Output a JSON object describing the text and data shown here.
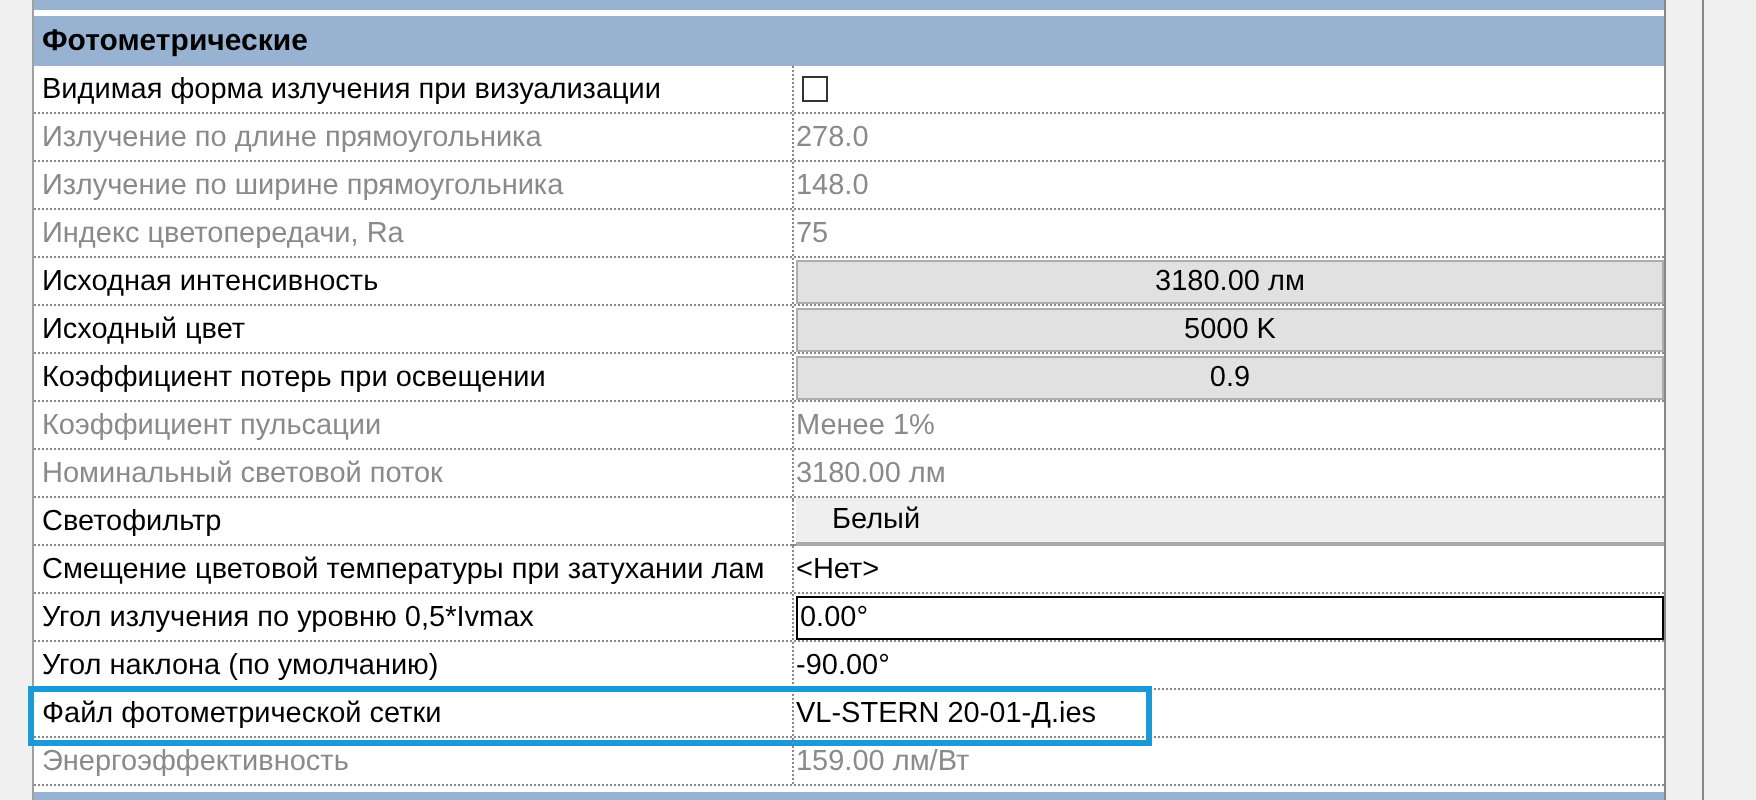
{
  "section": {
    "title": "Фотометрические"
  },
  "rows": [
    {
      "label": "Видимая форма излучения при визуализации",
      "kind": "checkbox",
      "checked": false,
      "disabled": false,
      "highlighted": false
    },
    {
      "label": "Излучение по длине прямоугольника",
      "kind": "text",
      "value": "278.0",
      "disabled": true,
      "highlighted": false
    },
    {
      "label": "Излучение по ширине прямоугольника",
      "kind": "text",
      "value": "148.0",
      "disabled": true,
      "highlighted": false
    },
    {
      "label": "Индекс цветопередачи, Ra",
      "kind": "text",
      "value": "75",
      "disabled": true,
      "highlighted": false
    },
    {
      "label": "Исходная интенсивность",
      "kind": "button",
      "value": "3180.00 лм",
      "disabled": false,
      "highlighted": false
    },
    {
      "label": "Исходный цвет",
      "kind": "button",
      "value": "5000 K",
      "disabled": false,
      "highlighted": false
    },
    {
      "label": "Коэффициент потерь при освещении",
      "kind": "button",
      "value": "0.9",
      "disabled": false,
      "highlighted": false
    },
    {
      "label": "Коэффициент пульсации",
      "kind": "text",
      "value": "Менее 1%",
      "disabled": true,
      "highlighted": false
    },
    {
      "label": "Номинальный световой поток",
      "kind": "text",
      "value": "3180.00 лм",
      "disabled": true,
      "highlighted": false
    },
    {
      "label": "Светофильтр",
      "kind": "dropdown",
      "value": "Белый",
      "disabled": false,
      "highlighted": false
    },
    {
      "label": "Смещение цветовой температуры при затухании лам",
      "kind": "text",
      "value": "<Нет>",
      "disabled": false,
      "highlighted": false
    },
    {
      "label": "Угол излучения по уровню 0,5*Ivmax",
      "kind": "input",
      "value": "0.00°",
      "disabled": false,
      "highlighted": false
    },
    {
      "label": "Угол наклона (по умолчанию)",
      "kind": "text",
      "value": "-90.00°",
      "disabled": false,
      "highlighted": false
    },
    {
      "label": "Файл фотометрической сетки",
      "kind": "text",
      "value": "VL-STERN 20-01-Д.ies",
      "disabled": false,
      "highlighted": true
    },
    {
      "label": "Энергоэффективность",
      "kind": "text",
      "value": "159.00 лм/Вт",
      "disabled": true,
      "highlighted": false
    }
  ]
}
